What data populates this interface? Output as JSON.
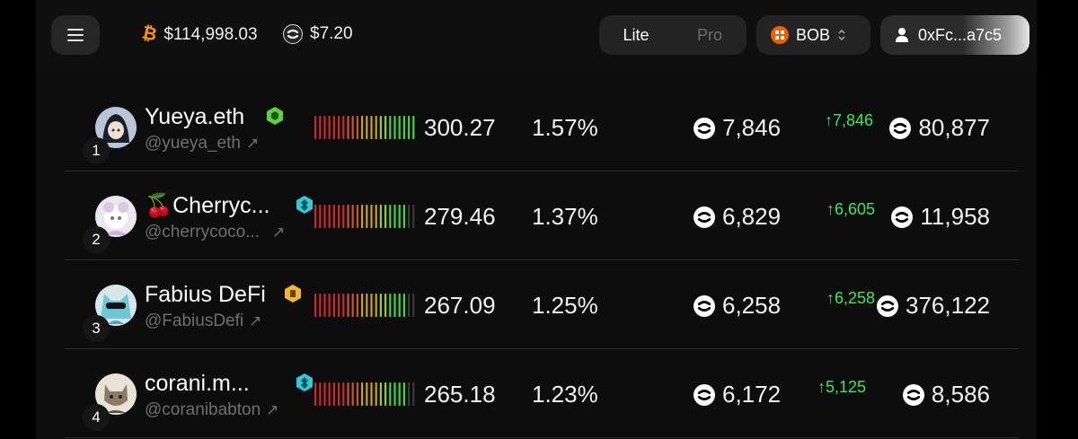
{
  "header": {
    "menu_icon": "hamburger-menu-icon",
    "btc_price": "$114,998.03",
    "bob_price": "$7.20",
    "mode_lite": "Lite",
    "mode_pro": "Pro",
    "chain_label": "BOB",
    "wallet_address": "0xFc...a7c5"
  },
  "colors": {
    "green": "#3ee65a",
    "btc_orange": "#f7931a",
    "bob_orange": "#f25d00"
  },
  "rows": [
    {
      "rank": "1",
      "name": "Yueya.eth",
      "handle": "@yueya_eth",
      "badge": "green-hex-badge",
      "score": "300.27",
      "share": "1.57%",
      "earned": "7,846",
      "delta": "7,846",
      "total": "80,877",
      "bar_level": 1.0
    },
    {
      "rank": "2",
      "name": "🍒Cherryc...",
      "handle": "@cherrycoco...",
      "badge": "cyan-hex-badge",
      "score": "279.46",
      "share": "1.37%",
      "earned": "6,829",
      "delta": "6,605",
      "total": "11,958",
      "bar_level": 0.9
    },
    {
      "rank": "3",
      "name": "Fabius DeFi",
      "handle": "@FabiusDefi",
      "badge": "gold-hex-badge",
      "score": "267.09",
      "share": "1.25%",
      "earned": "6,258",
      "delta": "6,258",
      "total": "376,122",
      "bar_level": 0.9
    },
    {
      "rank": "4",
      "name": "corani.m...",
      "handle": "@coranibabton",
      "badge": "cyan-hex-badge",
      "score": "265.18",
      "share": "1.23%",
      "earned": "6,172",
      "delta": "5,125",
      "total": "8,586",
      "bar_level": 0.9
    }
  ]
}
